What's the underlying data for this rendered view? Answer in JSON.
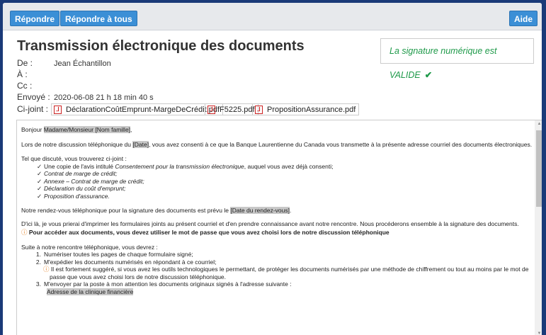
{
  "toolbar": {
    "reply": "Répondre",
    "reply_all": "Répondre à tous",
    "help": "Aide"
  },
  "email": {
    "subject": "Transmission électronique des documents",
    "signature_status": "La signature numérique est VALIDE",
    "from_label": "De :",
    "from_value": "Jean Échantillon",
    "to_label": "À :",
    "cc_label": "Cc :",
    "sent_label": "Envoyé :",
    "sent_value": "2020-06-08 21 h 18 min 40 s",
    "attach_label": "Ci-joint :",
    "attachments": [
      "DéclarationCoûtEmprunt-MargeDeCrédit.pdf",
      "F5225.pdf",
      "PropositionAssurance.pdf"
    ]
  },
  "message": {
    "greeting_prefix": "Bonjour",
    "greeting_name": "Madame/Monsieur [Nom famille]",
    "greeting_suffix": ",",
    "p1_a": "Lors de notre discussion téléphonique du",
    "p1_date": "[Date]",
    "p1_b": ", vous avez consenti à ce que la Banque Laurentienne du Canada vous transmette à la présente adresse courriel des documents électroniques.",
    "p2_intro": "Tel que discuté, vous trouverez ci-joint :",
    "bullet1_a": "Une copie de l'avis intitulé",
    "bullet1_b": "Consentement pour la transmission électronique",
    "bullet1_c": ", auquel vous avez déjà consenti;",
    "bullet2": "Contrat de marge de crédit;",
    "bullet3": "Annexe – Contrat de marge de crédit;",
    "bullet4": "Déclaration du coût d'emprunt;",
    "bullet5": "Proposition d'assurance.",
    "p3_a": "Notre rendez-vous téléphonique pour la signature des documents est prévu le",
    "p3_date": "[Date du rendez-vous]",
    "p3_b": ".",
    "p4": "D'ici là, je vous prierai d'imprimer les formulaires joints au présent courriel et d'en prendre connaissance avant notre rencontre. Nous procéderons ensemble à la signature des documents.",
    "p5": "Pour accéder aux documents, vous devez utiliser le mot de passe que vous avez choisi lors de notre discussion téléphonique",
    "p6_intro": "Suite à notre rencontre téléphonique, vous devrez :",
    "step1": "Numériser toutes les pages de chaque formulaire signé;",
    "step2": "M'expédier les documents numérisés en répondant à ce courriel;",
    "step2_note": "Il est fortement suggéré, si vous avez les outils technologiques le permettant, de protéger les documents numérisés par une méthode de chiffrement ou tout au moins par le mot de passe que vous avez choisi lors de notre discussion téléphonique.",
    "step3": "M'envoyer par la poste à mon attention les documents originaux signés à l'adresse suivante :",
    "address": "Adresse de la clinique financière"
  }
}
